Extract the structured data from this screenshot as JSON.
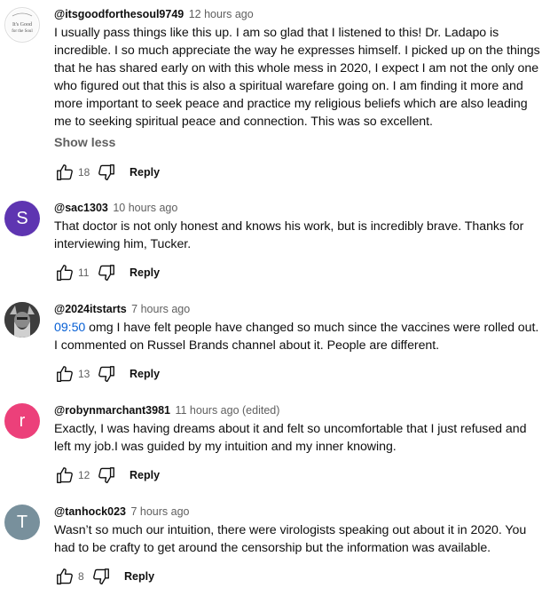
{
  "comments": [
    {
      "author": "@itsgoodforthesoul9749",
      "time": "12 hours ago",
      "avatar_letter": "",
      "avatar_color": "#ffffff",
      "avatar_text": [
        "It's Good",
        "for the Soul"
      ],
      "timestamp_link": "",
      "text": "I usually pass things like this up.  I am so glad that I listened to this!  Dr. Ladapo is incredible.  I so much appreciate the way he expresses himself.  I picked up on the things that he has shared early on with this whole mess in 2020, I expect I am not the only one who figured out that this is also a spiritual warefare going on. I am finding it more and more important to seek peace and practice my religious beliefs which are also leading me to seeking spiritual peace and connection.  This was so excellent.",
      "show_less": "Show less",
      "likes": "18",
      "reply": "Reply"
    },
    {
      "author": "@sac1303",
      "time": "10 hours ago",
      "avatar_letter": "S",
      "avatar_color": "#5e35b1",
      "timestamp_link": "",
      "text": "That doctor is not only honest and knows his work, but is incredibly brave.  Thanks for interviewing him, Tucker.",
      "likes": "11",
      "reply": "Reply"
    },
    {
      "author": "@2024itstarts",
      "time": "7 hours ago",
      "avatar_letter": "",
      "avatar_color": "#4a4a4a",
      "timestamp_link": "09:50",
      "text": " omg I have felt people have changed so much since the vaccines were rolled out. I commented on Russel Brands channel about it. People are different.",
      "likes": "13",
      "reply": "Reply"
    },
    {
      "author": "@robynmarchant3981",
      "time": "11 hours ago (edited)",
      "avatar_letter": "r",
      "avatar_color": "#ec407a",
      "timestamp_link": "",
      "text": "Exactly, I was having dreams about it and felt so uncomfortable that I just refused and left my job.I was guided by my intuition and my inner knowing.",
      "likes": "12",
      "reply": "Reply"
    },
    {
      "author": "@tanhock023",
      "time": "7 hours ago",
      "avatar_letter": "T",
      "avatar_color": "#78909c",
      "timestamp_link": "",
      "text": "Wasn’t so much our intuition, there were virologists speaking out about it in 2020. You had to be crafty to get around the censorship but the information was available.",
      "likes": "8",
      "reply": "Reply"
    }
  ]
}
